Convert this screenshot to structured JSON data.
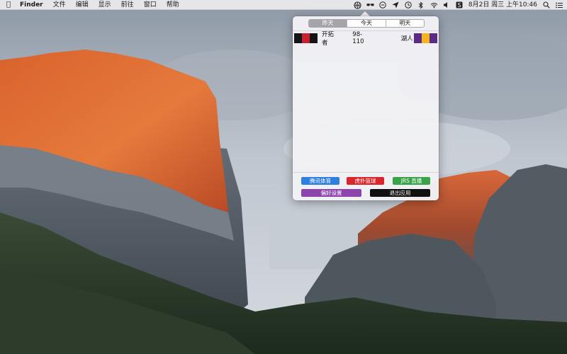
{
  "menubar": {
    "app_name": "Finder",
    "menus": [
      "文件",
      "编辑",
      "显示",
      "前往",
      "窗口",
      "帮助"
    ],
    "datetime": "8月2日 周三 上午10:46"
  },
  "popover": {
    "tabs": [
      {
        "label": "昨天",
        "active": true
      },
      {
        "label": "今天",
        "active": false
      },
      {
        "label": "明天",
        "active": false
      }
    ],
    "games": [
      {
        "home": "开拓者",
        "home_colors": [
          "#141414",
          "#c8202e",
          "#141414"
        ],
        "score": "98-110",
        "away": "湖人",
        "away_colors": [
          "#5b2a86",
          "#f4b41a",
          "#5b2a86"
        ]
      }
    ],
    "buttons": {
      "tencent_sports": {
        "label": "腾讯体育",
        "color": "#2f7fe0"
      },
      "hupu": {
        "label": "虎扑篮球",
        "color": "#d9262c"
      },
      "jrs": {
        "label": "JRS 直播",
        "color": "#3aa34a"
      },
      "preferences": {
        "label": "偏好设置",
        "color": "#8e44ad"
      },
      "quit": {
        "label": "退出应用",
        "color": "#111111"
      }
    }
  }
}
